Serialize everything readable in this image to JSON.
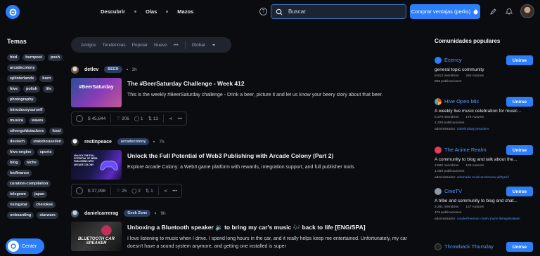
{
  "header": {
    "nav": [
      "Descubrir",
      "Olas",
      "Mazos"
    ],
    "search_placeholder": "Buscar",
    "cta_label": "Comprar ventajas (perks)"
  },
  "left": {
    "title": "Temas",
    "tags": [
      "hbd",
      "burnpost",
      "posh",
      "arcadecolony",
      "splinterlands",
      "burn",
      "hive",
      "polish",
      "life",
      "photography",
      "introduceyourself",
      "musica",
      "waves",
      "silvergoldstackers",
      "food",
      "deutsch",
      "stakehouseden",
      "hive-engine",
      "sports",
      "blog",
      "niche",
      "leofinance",
      "curation-compilation",
      "telegram",
      "japan",
      "risingstar",
      "cherokee",
      "onboarding",
      "starwars"
    ],
    "center_label": "Center"
  },
  "filters": {
    "items": [
      "Amigos",
      "Tendencias",
      "Popular",
      "Nuevo",
      "•••"
    ],
    "scope": "Global"
  },
  "posts": [
    {
      "author": "detlev",
      "community": "BEER",
      "time": "3h",
      "title": "The #BeerSaturday Challenge - Week 412",
      "excerpt": "This is the weekly #BeerSaturday challenge - Drink a beer, picture it and let us know your beery story about that beer.",
      "payout": "$ 45,844",
      "votes": "206",
      "comments": "1",
      "reblogs": "13",
      "thumb_text": "#BeerSaturday"
    },
    {
      "author": "restinpeace",
      "community": "arcadecolony",
      "time": "7h",
      "title": "Unlock the Full Potential of Web3 Publishing with Arcade Colony (Part 2)",
      "excerpt": "Explore Arcade Colony: a Web3 game platform with rewards, integration support, and full publisher tools.",
      "payout": "$ 37,996",
      "votes": "25",
      "comments": "2",
      "reblogs": "1",
      "thumb_text": "UNLOCK THE FULL POTENTIAL OF WEB3 PUBLISHING WITH ARCADE COLONY"
    },
    {
      "author": "danielcarrerag",
      "community": "Geek Zone",
      "time": "9h",
      "title": "Unboxing a Bluetooth speaker 🔉 to bring my car's music 🎶 back to life [ENG/SPA]",
      "excerpt": "I love listening to music when I drive. I spend long hours in the car, and it really helps keep me entertained. Unfortunately, my car doesn't have a sound system anymore, and getting one installed is super",
      "thumb_text": "BLUETOOTH CAR SPEAKER"
    }
  ],
  "right": {
    "title": "Comunidades populares",
    "join_label": "Unirse",
    "communities": [
      {
        "name": "Ecency",
        "desc": "general topic community",
        "members": "9,513 miembros",
        "authors": "255 Autores",
        "pubs": "908 publicaciones",
        "admin_label": "",
        "admins": "",
        "color": "#2d7ff9"
      },
      {
        "name": "Hive Open Mic",
        "desc": "A weekly live music celebration for music...",
        "members": "5,379 miembros",
        "authors": "175 Autores",
        "pubs": "1,228 publicaciones",
        "admin_label": "administrador:",
        "admins": "cabeiindsay jesusinrs",
        "color": "#e34a3a"
      },
      {
        "name": "The Anime Realm",
        "desc": "A community to blog and talk about the...",
        "members": "2,582 miembros",
        "authors": "129 Autores",
        "pubs": "1,059 publicaciones",
        "admin_label": "administrador:",
        "admins": "adamada musicandreview wiftyzeil",
        "color": "#e53a5a"
      },
      {
        "name": "CineTV",
        "desc": "A tribe and community to blog and chat...",
        "members": "3,291 miembros",
        "authors": "147 Autores",
        "pubs": "476 publicaciones",
        "admin_label": "administrador:",
        "admins": "cauderfreeman cinetv jhymi livinguktaiwan",
        "color": "#8f9aa8"
      },
      {
        "name": "Throwback Thursday",
        "desc": "",
        "members": "",
        "authors": "",
        "pubs": "",
        "admin_label": "",
        "admins": "",
        "color": "#222222"
      }
    ]
  }
}
